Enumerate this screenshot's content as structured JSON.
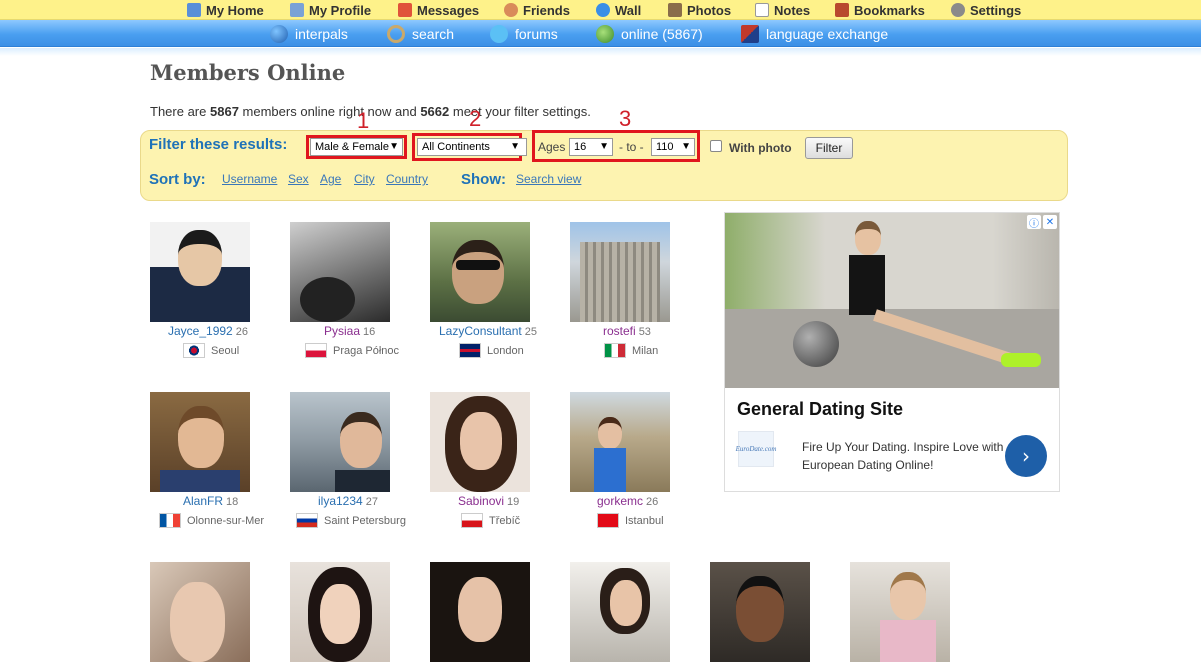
{
  "topnav": [
    {
      "label": "My Home",
      "icon": "home-icon",
      "color": "#5a8fd8"
    },
    {
      "label": "My Profile",
      "icon": "profile-icon",
      "color": "#7aa2d6"
    },
    {
      "label": "Messages",
      "icon": "envelope-icon",
      "color": "#e0533a"
    },
    {
      "label": "Friends",
      "icon": "friends-icon",
      "color": "#d98b5a"
    },
    {
      "label": "Wall",
      "icon": "wall-icon",
      "color": "#3a8ee6"
    },
    {
      "label": "Photos",
      "icon": "photos-icon",
      "color": "#8a6d4a"
    },
    {
      "label": "Notes",
      "icon": "notes-icon",
      "color": "#cfcfcf"
    },
    {
      "label": "Bookmarks",
      "icon": "bookmarks-icon",
      "color": "#b84a2e"
    },
    {
      "label": "Settings",
      "icon": "settings-icon",
      "color": "#8a8a8a"
    }
  ],
  "mainnav": [
    {
      "label": "interpals",
      "icon": "globe-icon",
      "color": "#2d6fc2"
    },
    {
      "label": "search",
      "icon": "magnifier-icon",
      "color": "#c9a96b"
    },
    {
      "label": "forums",
      "icon": "chat-bubble-icon",
      "color": "#5bc0f5"
    },
    {
      "label": "online (5867)",
      "icon": "online-user-icon",
      "color": "#6ab04c"
    },
    {
      "label": "language exchange",
      "icon": "flags-icon",
      "color": "#c0392b"
    }
  ],
  "page": {
    "title": "Members Online",
    "summary": {
      "prefix": "There are",
      "online_count": "5867",
      "middle": "members online right now and",
      "match_count": "5662",
      "suffix": "meet your filter settings."
    }
  },
  "annotations": [
    "1",
    "2",
    "3"
  ],
  "filter": {
    "label": "Filter these results:",
    "gender": "Male & Female",
    "continent": "All Continents",
    "ages_label": "Ages",
    "age_from": "16",
    "to_label": "- to -",
    "age_to": "110",
    "with_photo": "With photo",
    "button": "Filter",
    "sort_label": "Sort by:",
    "sort_options": [
      "Username",
      "Sex",
      "Age",
      "City",
      "Country"
    ],
    "show_label": "Show:",
    "show_option": "Search view"
  },
  "members": [
    {
      "username": "Jayce_1992",
      "age": "26",
      "city": "Seoul",
      "gender": "male",
      "flag": "kr"
    },
    {
      "username": "Pysiaa",
      "age": "16",
      "city": "Praga Północ",
      "gender": "female",
      "flag": "pl"
    },
    {
      "username": "LazyConsultant",
      "age": "25",
      "city": "London",
      "gender": "male",
      "flag": "gb"
    },
    {
      "username": "rostefi",
      "age": "53",
      "city": "Milan",
      "gender": "female",
      "flag": "it"
    },
    {
      "username": "AlanFR",
      "age": "18",
      "city": "Olonne-sur-Mer",
      "gender": "male",
      "flag": "fr"
    },
    {
      "username": "ilya1234",
      "age": "27",
      "city": "Saint Petersburg",
      "gender": "male",
      "flag": "ru"
    },
    {
      "username": "Sabinovi",
      "age": "19",
      "city": "Třebíč",
      "gender": "female",
      "flag": "cz"
    },
    {
      "username": "gorkemc",
      "age": "26",
      "city": "Istanbul",
      "gender": "female",
      "flag": "tr"
    }
  ],
  "colors": {
    "male": "#2a6fb0",
    "female": "#8a2f8f",
    "accent": "#1f72b8",
    "annotation": "#e0161e"
  },
  "ad": {
    "title": "General Dating Site",
    "logo_text": "EuroDate.com",
    "text": "Fire Up Your Dating. Inspire Love with European Dating Online!"
  }
}
